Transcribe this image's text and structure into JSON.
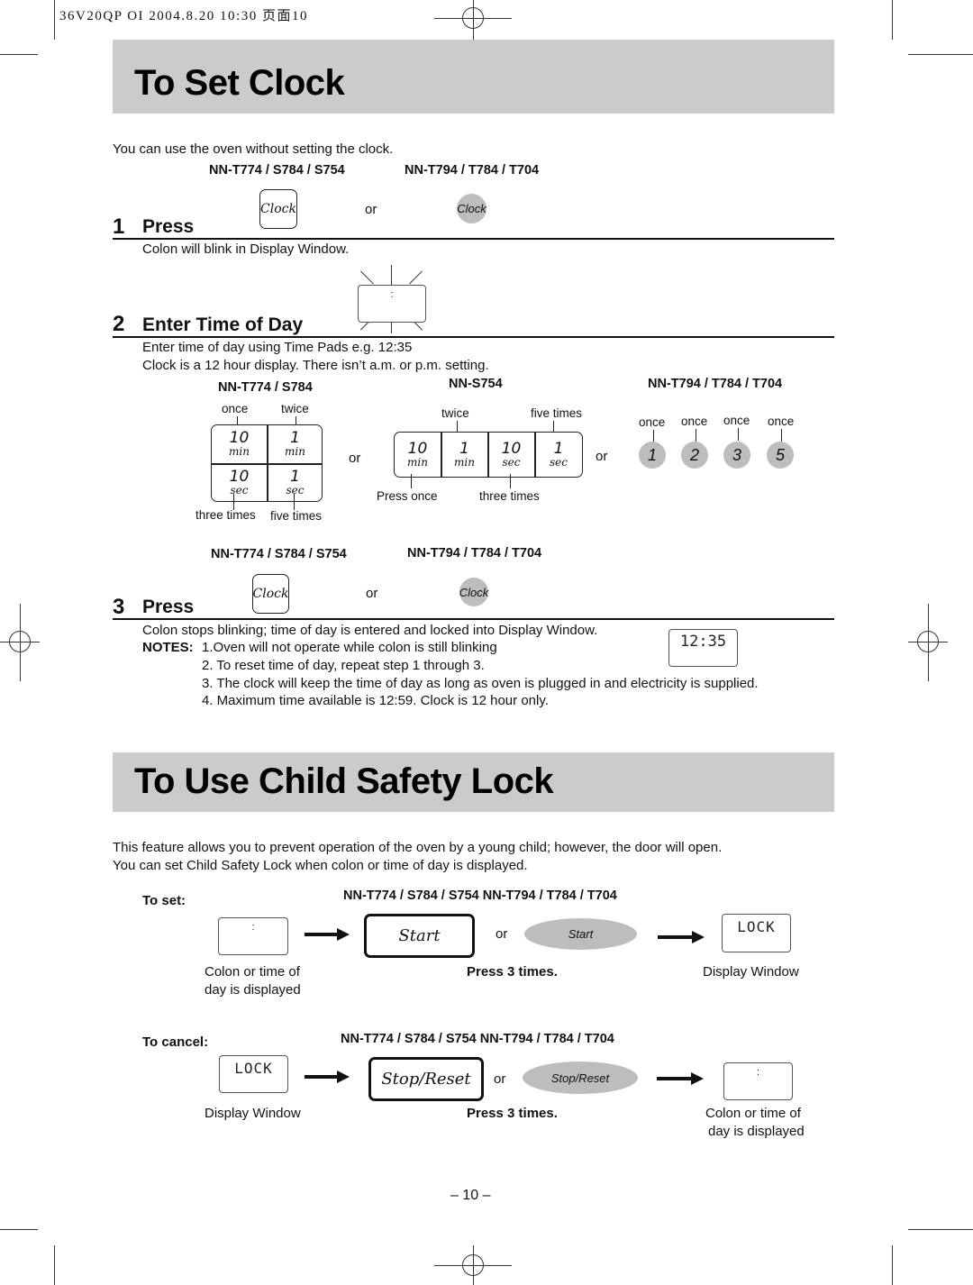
{
  "print_header": "36V20QP OI  2004.8.20 10:30  页面10",
  "clock_section": {
    "title": "To Set Clock",
    "intro": "You can use the oven without setting the clock.",
    "models": {
      "group_a": "NN-T774 / S784 / S754",
      "group_b": "NN-T794 / T784 / T704"
    },
    "step1": {
      "number": "1",
      "title": "Press",
      "button_a": "Clock",
      "or": "or",
      "button_b": "Clock",
      "description": "Colon will blink in Display Window.",
      "display": ":"
    },
    "step2": {
      "number": "2",
      "title": "Enter Time of Day",
      "line1": "Enter time of day using Time Pads e.g. 12:35",
      "line2": "Clock is a 12 hour display. There isn’t a.m. or p.m. setting.",
      "model_pad_a": "NN-T774 / S784",
      "model_pad_b": "NN-S754",
      "model_pad_c": "NN-T794 / T784 / T704",
      "or": "or",
      "pad_a": {
        "cells": [
          {
            "num": "10",
            "unit": "min",
            "label": "once"
          },
          {
            "num": "1",
            "unit": "min",
            "label": "twice"
          },
          {
            "num": "10",
            "unit": "sec",
            "label": "three times"
          },
          {
            "num": "1",
            "unit": "sec",
            "label": "five times"
          }
        ]
      },
      "pad_b": {
        "cells": [
          {
            "num": "10",
            "unit": "min",
            "label": "Press once"
          },
          {
            "num": "1",
            "unit": "min",
            "label": "twice"
          },
          {
            "num": "10",
            "unit": "sec",
            "label": "three times"
          },
          {
            "num": "1",
            "unit": "sec",
            "label": "five times"
          }
        ]
      },
      "pad_c": {
        "buttons": [
          {
            "num": "1",
            "label": "once"
          },
          {
            "num": "2",
            "label": "once"
          },
          {
            "num": "3",
            "label": "once"
          },
          {
            "num": "5",
            "label": "once"
          }
        ]
      }
    },
    "step3": {
      "number": "3",
      "title": "Press",
      "button_a": "Clock",
      "or": "or",
      "button_b": "Clock",
      "description": "Colon stops blinking; time of day is entered and locked into Display Window.",
      "display": "12:35",
      "notes_label": "NOTES:",
      "notes": [
        "1.Oven will not operate while colon is still blinking",
        "2. To reset time of day, repeat step 1 through 3.",
        "3. The clock will keep the time of day as long as oven is plugged in and electricity is supplied.",
        "4. Maximum time available is 12:59. Clock is 12 hour only."
      ]
    }
  },
  "lock_section": {
    "title": "To Use Child Safety Lock",
    "intro1": "This feature allows you to prevent operation of the oven by a young child; however, the door will open.",
    "intro2": "You can set Child Safety Lock when colon or time of day is displayed.",
    "models": "NN-T774 / S784 / S754   NN-T794 / T784 / T704",
    "to_set": {
      "label": "To set:",
      "display_start": ":",
      "caption_start_1": "Colon or time of",
      "caption_start_2": "day is displayed",
      "button_a": "Start",
      "or": "or",
      "button_b": "Start",
      "press": "Press 3 times.",
      "display_end": "LOCK",
      "caption_end": "Display Window"
    },
    "to_cancel": {
      "label": "To cancel:",
      "display_start": "LOCK",
      "caption_start": "Display Window",
      "button_a": "Stop/Reset",
      "or": "or",
      "button_b": "Stop/Reset",
      "press": "Press 3 times.",
      "display_end": ":",
      "caption_end_1": "Colon or time of",
      "caption_end_2": "day is displayed"
    }
  },
  "page_number": "– 10 –"
}
